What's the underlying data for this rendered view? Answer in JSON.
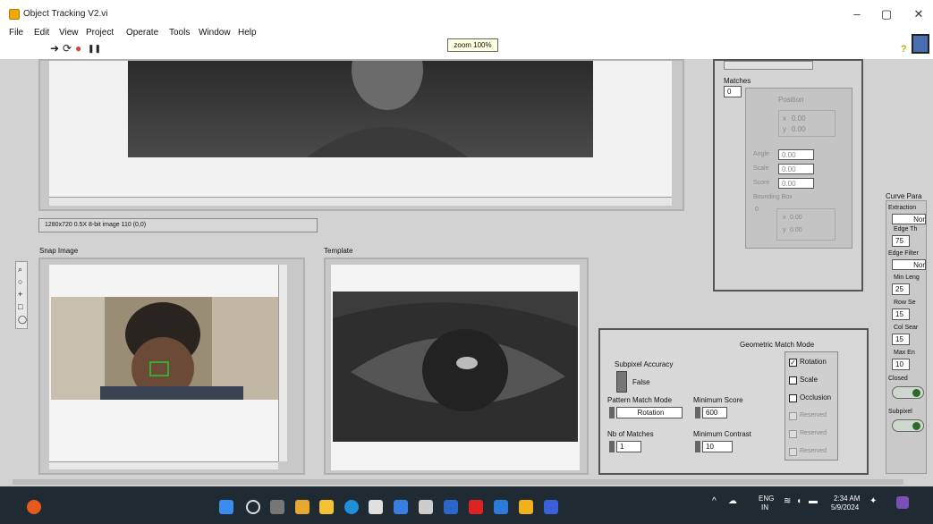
{
  "window": {
    "title": "Object Tracking V2.vi",
    "controls": {
      "minimize": "–",
      "maximize": "▢",
      "close": "✕"
    }
  },
  "menu": [
    "File",
    "Edit",
    "View",
    "Project",
    "Operate",
    "Tools",
    "Window",
    "Help"
  ],
  "toolbar": {
    "run": "➜",
    "run_continuous": "⟳",
    "abort": "●",
    "pause": "❚❚"
  },
  "tooltip": "zoom 100%",
  "help_icon": "?",
  "image_status": "1280x720 0.5X 8-bit image 110    (0,0)",
  "snap_label": "Snap Image",
  "template_label": "Template",
  "matches_panel": {
    "matches_label": "Matches",
    "index": "0",
    "position_label": "Position",
    "x_label": "x",
    "x_value": "0.00",
    "y_label": "y",
    "y_value": "0.00",
    "angle_label": "Angle",
    "angle_value": "0.00",
    "scale_label": "Scale",
    "scale_value": "0.00",
    "score_label": "Score",
    "score_value": "0.00",
    "bbox_label": "Bounding Box",
    "bbox_index": "0",
    "bbox_x_label": "x",
    "bbox_x_value": "0.00",
    "bbox_y_label": "y",
    "bbox_y_value": "0.00"
  },
  "settings_panel": {
    "geometric_title": "Geometric Match Mode",
    "subpixel_label": "Subpixel Accuracy",
    "subpixel_value": "False",
    "pattern_mode_label": "Pattern Match Mode",
    "pattern_mode_value": "Rotation",
    "min_score_label": "Minimum Score",
    "min_score_value": "600",
    "nb_matches_label": "Nb of Matches",
    "nb_matches_value": "1",
    "min_contrast_label": "Minimum Contrast",
    "min_contrast_value": "10",
    "modes": [
      {
        "label": "Rotation",
        "checked": true,
        "enabled": true
      },
      {
        "label": "Scale",
        "checked": false,
        "enabled": true
      },
      {
        "label": "Occlusion",
        "checked": false,
        "enabled": true
      },
      {
        "label": "Reserved",
        "checked": false,
        "enabled": false
      },
      {
        "label": "Reserved",
        "checked": false,
        "enabled": false
      },
      {
        "label": "Reserved",
        "checked": false,
        "enabled": false
      }
    ]
  },
  "curve_panel": {
    "title": "Curve Para",
    "extraction_label": "Extraction",
    "extraction_value": "Nor",
    "edge_threshold_label": "Edge Th",
    "edge_threshold_value": "75",
    "edge_filter_label": "Edge Filter",
    "edge_filter_value": "Nor",
    "min_length_label": "Min Leng",
    "min_length_value": "25",
    "row_search_label": "Row Se",
    "row_search_value": "15",
    "col_search_label": "Col Sear",
    "col_search_value": "15",
    "max_endpoint_label": "Max En",
    "max_endpoint_value": "10",
    "closed_label": "Closed",
    "subpixel_label": "Subpixel"
  },
  "taskbar": {
    "lang_top": "ENG",
    "lang_bottom": "IN",
    "time": "2:34 AM",
    "date": "5/9/2024"
  },
  "colors": {
    "panel_bg": "#d2d2d2",
    "taskbar_bg": "#1f2a33",
    "title_icon": "#f2a900",
    "tracking_box": "#2fc42f"
  }
}
